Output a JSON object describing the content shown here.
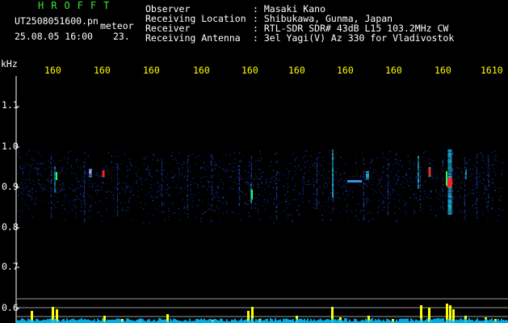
{
  "header": {
    "brand": "HROFFT",
    "filename": "UT2508051600.pn",
    "detector": "meteor",
    "datetime": "25.08.05 16:00",
    "count": "23.",
    "info": [
      {
        "label": "Observer",
        "value": ": Masaki Kano"
      },
      {
        "label": "Receiving Location",
        "value": ": Shibukawa, Gunma, Japan"
      },
      {
        "label": "Receiver",
        "value": ": RTL-SDR SDR# 43dB L15 103.2MHz CW"
      },
      {
        "label": "Receiving Antenna",
        "value": ": 3el Yagi(V) Az 330 for Vladivostok"
      }
    ]
  },
  "axis": {
    "unit": "kHz",
    "y_ticks": [
      "1.1",
      "1.0",
      "0.9",
      "0.8",
      "0.7",
      "0.6"
    ],
    "time_ticks": [
      "160",
      "160",
      "160",
      "160",
      "160",
      "160",
      "160",
      "160",
      "160",
      "1610"
    ]
  },
  "colors": {
    "background": "#000000",
    "text": "#ffffff",
    "brand": "#38e838",
    "axis_labels": "#ffff00",
    "noise": "#1533b8",
    "meteor_core": "#ff2020",
    "meteor_glow": "#20d0ff",
    "meteor_green": "#20ff60",
    "baseline": "#00bfff",
    "bars": "#ffff00"
  }
}
